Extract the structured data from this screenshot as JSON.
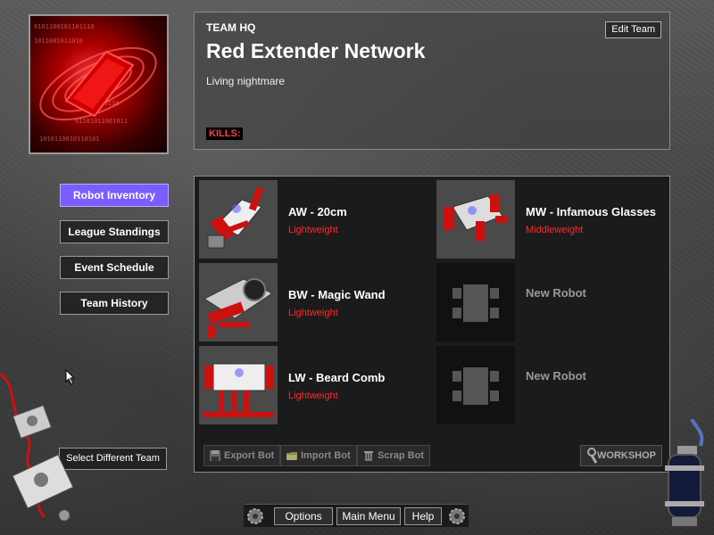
{
  "header": {
    "kicker": "TEAM HQ",
    "team_name": "Red Extender Network",
    "motto": "Living nightmare",
    "kills_label": "KILLS:",
    "edit_team_label": "Edit Team"
  },
  "nav": {
    "items": [
      {
        "label": "Robot Inventory",
        "active": true
      },
      {
        "label": "League Standings",
        "active": false
      },
      {
        "label": "Event Schedule",
        "active": false
      },
      {
        "label": "Team History",
        "active": false
      }
    ],
    "select_team_label": "Select Different Team"
  },
  "robots": [
    {
      "name": "AW - 20cm",
      "class": "Lightweight"
    },
    {
      "name": "MW - Infamous Glasses",
      "class": "Middleweight"
    },
    {
      "name": "BW - Magic Wand",
      "class": "Lightweight"
    },
    {
      "name": "New Robot",
      "class": ""
    },
    {
      "name": "LW - Beard Comb",
      "class": "Lightweight"
    },
    {
      "name": "New Robot",
      "class": ""
    }
  ],
  "panel_actions": {
    "export_label": "Export Bot",
    "import_label": "Import Bot",
    "scrap_label": "Scrap Bot",
    "workshop_label": "WORKSHOP"
  },
  "bottom_bar": {
    "options_label": "Options",
    "main_menu_label": "Main Menu",
    "help_label": "Help"
  },
  "icons": {
    "save": "floppy-disk-icon",
    "folder": "folder-icon",
    "trash": "trash-icon",
    "wrench": "wrench-icon",
    "gear": "gear-icon"
  },
  "colors": {
    "accent": "#7b5cff",
    "weight_class": "#ff2a2a",
    "kills": "#ff4040"
  }
}
